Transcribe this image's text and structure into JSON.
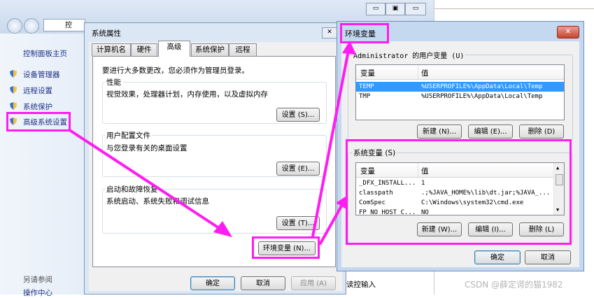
{
  "control_panel": {
    "address": "控",
    "home": "控制面板主页",
    "items": [
      "设备管理器",
      "远程设置",
      "系统保护",
      "高级系统设置"
    ],
    "see_also": "另请参阅",
    "action_center": "操作中心",
    "status_fragment": "读控输入"
  },
  "sys_props": {
    "title": "系统属性",
    "tabs": [
      "计算机名",
      "硬件",
      "高级",
      "系统保护",
      "远程"
    ],
    "admin_note": "要进行大多数更改，您必须作为管理员登录。",
    "perf_title": "性能",
    "perf_desc": "视觉效果，处理器计划，内存使用，以及虚拟内存",
    "profile_title": "用户配置文件",
    "profile_desc": "与您登录有关的桌面设置",
    "startup_title": "启动和故障恢复",
    "startup_desc": "系统启动、系统失败和调试信息",
    "settings_s": "设置 (S)...",
    "settings_e": "设置 (E)...",
    "settings_t": "设置 (T)...",
    "env_button": "环境变量 (N)...",
    "ok": "确定",
    "cancel": "取消",
    "apply": "应用 (A)"
  },
  "env_vars": {
    "title": "环境变量",
    "user_group": "Administrator 的用户变量 (U)",
    "col_var": "变量",
    "col_val": "值",
    "user_rows": [
      {
        "name": "TEMP",
        "value": "%USERPROFILE%\\AppData\\Local\\Temp"
      },
      {
        "name": "TMP",
        "value": "%USERPROFILE%\\AppData\\Local\\Temp"
      }
    ],
    "user_new": "新建 (N)...",
    "user_edit": "编辑 (E)...",
    "user_delete": "删除 (D)",
    "sys_group": "系统变量 (S)",
    "sys_rows": [
      {
        "name": "_DFX_INSTALL...",
        "value": "1"
      },
      {
        "name": "classpath",
        "value": ".;%JAVA_HOME%\\lib\\dt.jar;%JAVA_..."
      },
      {
        "name": "ComSpec",
        "value": "C:\\Windows\\system32\\cmd.exe"
      },
      {
        "name": "FP_NO_HOST_C...",
        "value": "NO"
      }
    ],
    "sys_new": "新建 (W)...",
    "sys_edit": "编辑 (I)...",
    "sys_delete": "删除 (L)",
    "ok": "确定",
    "cancel": "取消"
  },
  "watermark": "CSDN @薛定谔的猫1982",
  "colors": {
    "highlight": "#ff1cf2",
    "selection": "#3399ff"
  }
}
